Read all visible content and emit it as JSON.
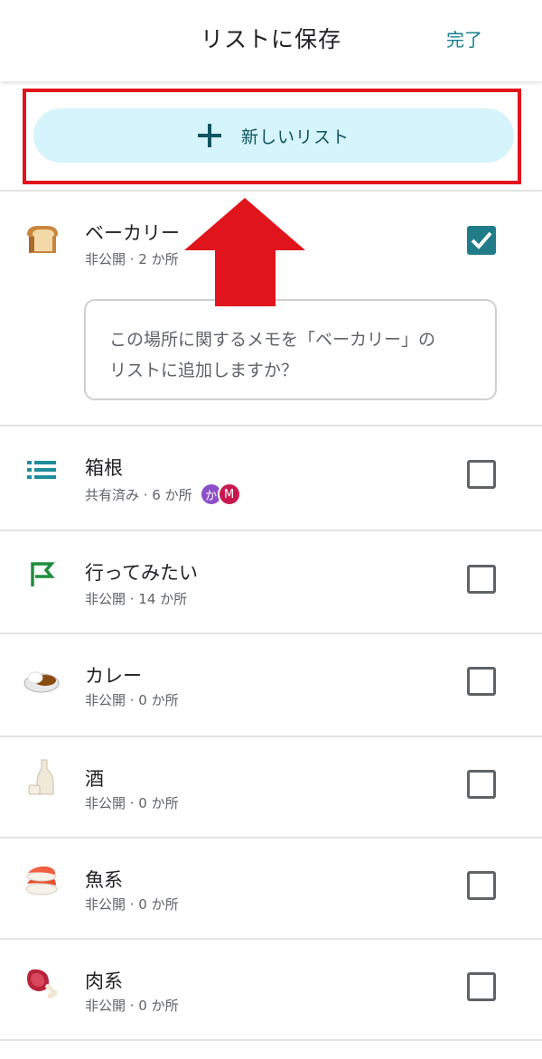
{
  "header": {
    "title": "リストに保存",
    "done_label": "完了"
  },
  "new_list": {
    "label": "新しいリスト"
  },
  "memo": {
    "line1": "この場所に関するメモを「ベーカリー」の",
    "line2": "リストに追加しますか？"
  },
  "lists": [
    {
      "name": "ベーカリー",
      "meta": "非公開 · 2 か所",
      "icon": "bread-icon",
      "checked": true
    },
    {
      "name": "箱根",
      "meta": "共有済み · 6 か所",
      "icon": "list-icon",
      "checked": false,
      "avatars": [
        "か",
        "M"
      ]
    },
    {
      "name": "行ってみたい",
      "meta": "非公開 · 14 か所",
      "icon": "flag-icon",
      "checked": false
    },
    {
      "name": "カレー",
      "meta": "非公開 · 0 か所",
      "icon": "curry-icon",
      "checked": false
    },
    {
      "name": "酒",
      "meta": "非公開 · 0 か所",
      "icon": "sake-icon",
      "checked": false
    },
    {
      "name": "魚系",
      "meta": "非公開 · 0 か所",
      "icon": "sushi-icon",
      "checked": false
    },
    {
      "name": "肉系",
      "meta": "非公開 · 0 か所",
      "icon": "meat-icon",
      "checked": false
    }
  ],
  "colors": {
    "accent": "#1f7c88",
    "new_list_bg": "#d6f4fb",
    "highlight_red": "#e0141c"
  }
}
